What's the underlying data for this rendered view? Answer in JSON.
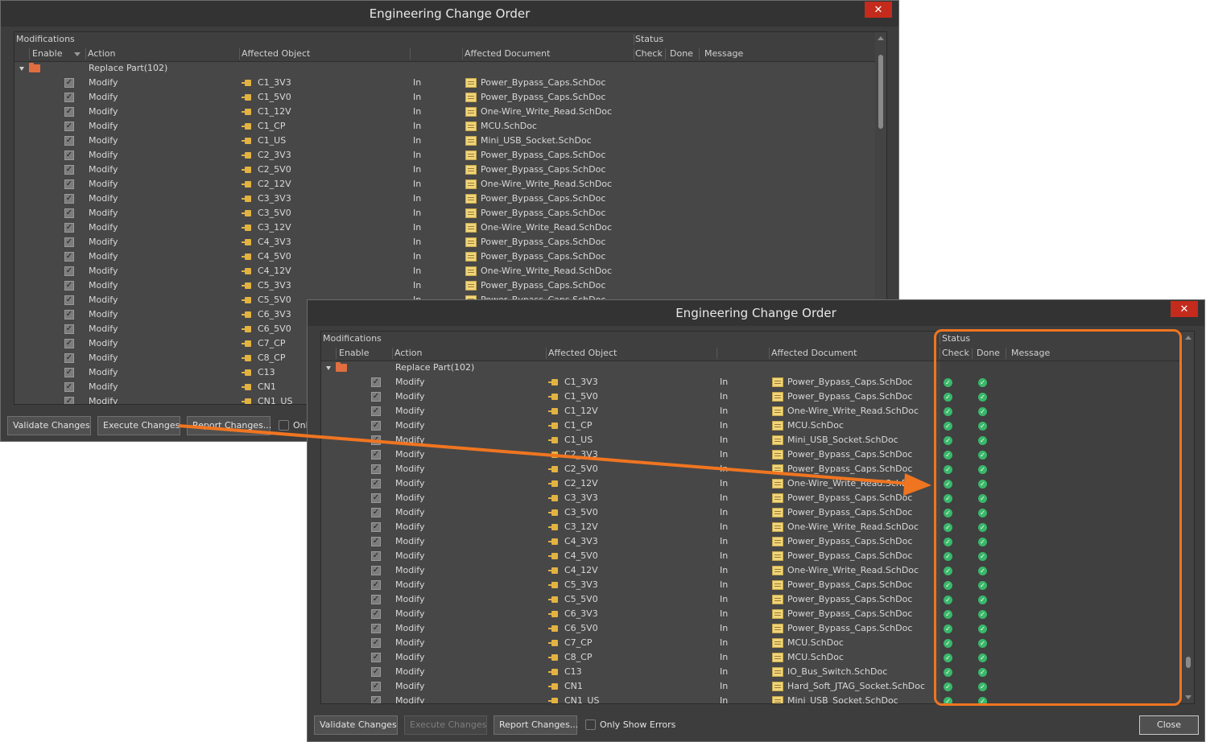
{
  "back_window": {
    "title": "Engineering Change Order",
    "close_glyph": "✕",
    "header_group": {
      "modifications": "Modifications",
      "status": "Status"
    },
    "columns": {
      "enable": "Enable",
      "action": "Action",
      "affected_object": "Affected Object",
      "affected_document": "Affected Document",
      "check": "Check",
      "done": "Done",
      "message": "Message"
    },
    "group": {
      "label": "Replace Part(102)"
    },
    "rows": [
      {
        "action": "Modify",
        "object": "C1_3V3",
        "in": "In",
        "doc": "Power_Bypass_Caps.SchDoc"
      },
      {
        "action": "Modify",
        "object": "C1_5V0",
        "in": "In",
        "doc": "Power_Bypass_Caps.SchDoc"
      },
      {
        "action": "Modify",
        "object": "C1_12V",
        "in": "In",
        "doc": "One-Wire_Write_Read.SchDoc"
      },
      {
        "action": "Modify",
        "object": "C1_CP",
        "in": "In",
        "doc": "MCU.SchDoc"
      },
      {
        "action": "Modify",
        "object": "C1_US",
        "in": "In",
        "doc": "Mini_USB_Socket.SchDoc"
      },
      {
        "action": "Modify",
        "object": "C2_3V3",
        "in": "In",
        "doc": "Power_Bypass_Caps.SchDoc"
      },
      {
        "action": "Modify",
        "object": "C2_5V0",
        "in": "In",
        "doc": "Power_Bypass_Caps.SchDoc"
      },
      {
        "action": "Modify",
        "object": "C2_12V",
        "in": "In",
        "doc": "One-Wire_Write_Read.SchDoc"
      },
      {
        "action": "Modify",
        "object": "C3_3V3",
        "in": "In",
        "doc": "Power_Bypass_Caps.SchDoc"
      },
      {
        "action": "Modify",
        "object": "C3_5V0",
        "in": "In",
        "doc": "Power_Bypass_Caps.SchDoc"
      },
      {
        "action": "Modify",
        "object": "C3_12V",
        "in": "In",
        "doc": "One-Wire_Write_Read.SchDoc"
      },
      {
        "action": "Modify",
        "object": "C4_3V3",
        "in": "In",
        "doc": "Power_Bypass_Caps.SchDoc"
      },
      {
        "action": "Modify",
        "object": "C4_5V0",
        "in": "In",
        "doc": "Power_Bypass_Caps.SchDoc"
      },
      {
        "action": "Modify",
        "object": "C4_12V",
        "in": "In",
        "doc": "One-Wire_Write_Read.SchDoc"
      },
      {
        "action": "Modify",
        "object": "C5_3V3",
        "in": "In",
        "doc": "Power_Bypass_Caps.SchDoc"
      },
      {
        "action": "Modify",
        "object": "C5_5V0",
        "in": "In",
        "doc": "Power_Bypass_Caps.SchDoc"
      },
      {
        "action": "Modify",
        "object": "C6_3V3",
        "in": "In",
        "doc": "Power_Bypass_Caps.SchDoc"
      },
      {
        "action": "Modify",
        "object": "C6_5V0",
        "in": "In",
        "doc": "Power_Bypass_Caps.SchDoc"
      },
      {
        "action": "Modify",
        "object": "C7_CP",
        "in": "In",
        "doc": "MCU.SchDoc"
      },
      {
        "action": "Modify",
        "object": "C8_CP",
        "in": "In",
        "doc": "MCU.SchDoc"
      },
      {
        "action": "Modify",
        "object": "C13",
        "in": "In",
        "doc": "IO_Bus_Switch.SchDoc"
      },
      {
        "action": "Modify",
        "object": "CN1",
        "in": "In",
        "doc": "Hard_Soft_JTAG_Socket.SchDoc"
      },
      {
        "action": "Modify",
        "object": "CN1_US",
        "in": "In",
        "doc": "Mini_USB_Socket.SchDoc"
      }
    ],
    "buttons": {
      "validate": "Validate Changes",
      "execute": "Execute Changes",
      "report": "Report Changes...",
      "only_errors": "Onl"
    }
  },
  "front_window": {
    "title": "Engineering Change Order",
    "close_glyph": "✕",
    "header_group": {
      "modifications": "Modifications",
      "status": "Status"
    },
    "columns": {
      "enable": "Enable",
      "action": "Action",
      "affected_object": "Affected Object",
      "affected_document": "Affected Document",
      "check": "Check",
      "done": "Done",
      "message": "Message"
    },
    "group": {
      "label": "Replace Part(102)"
    },
    "status_glyph": "✓",
    "buttons": {
      "validate": "Validate Changes",
      "execute": "Execute Changes",
      "report": "Report Changes...",
      "only_errors": "Only Show Errors",
      "close": "Close"
    }
  },
  "colors": {
    "highlight": "#f07520",
    "ok_icon": "#39b86a",
    "window_bg": "#3d3d3d"
  }
}
